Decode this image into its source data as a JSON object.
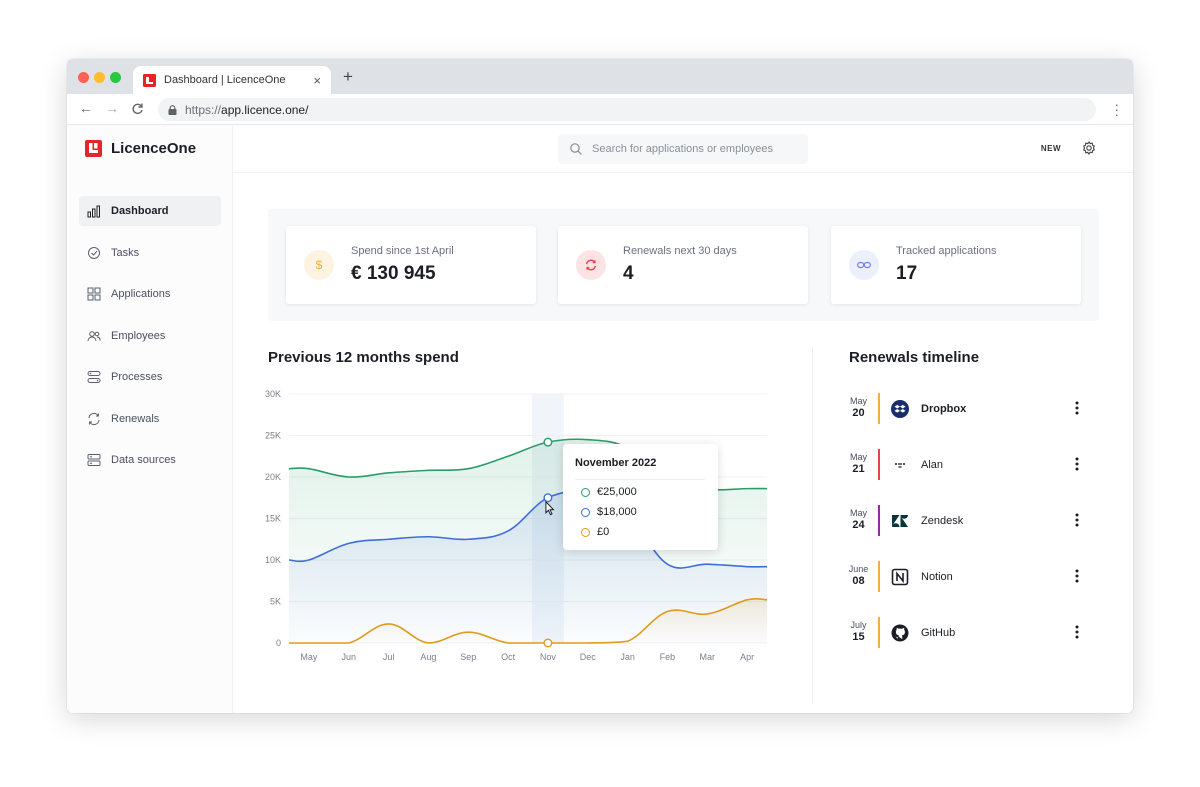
{
  "browser": {
    "tab_title": "Dashboard | LicenceOne",
    "tab_close": "×",
    "new_tab": "+",
    "url_protocol": "https://",
    "url_host": "app.licence.one/",
    "back": "←",
    "forward": "→",
    "reload": "C"
  },
  "app": {
    "logo_text": "LicenceOne",
    "brand_color": "#e8242b"
  },
  "sidebar": {
    "items": [
      {
        "label": "Dashboard",
        "icon": "bar-chart-icon",
        "active": true
      },
      {
        "label": "Tasks",
        "icon": "check-circle-icon",
        "active": false
      },
      {
        "label": "Applications",
        "icon": "grid-icon",
        "active": false
      },
      {
        "label": "Employees",
        "icon": "users-icon",
        "active": false
      },
      {
        "label": "Processes",
        "icon": "flow-icon",
        "active": false
      },
      {
        "label": "Renewals",
        "icon": "refresh-icon",
        "active": false
      },
      {
        "label": "Data sources",
        "icon": "server-icon",
        "active": false
      }
    ]
  },
  "header": {
    "search_placeholder": "Search for applications or employees",
    "new_label": "NEW"
  },
  "kpis": [
    {
      "label": "Spend since 1st April",
      "value": "€ 130 945",
      "icon": "dollar-icon",
      "color": "#f0b03a"
    },
    {
      "label": "Renewals next 30 days",
      "value": "4",
      "icon": "refresh-icon",
      "color": "#e8424a"
    },
    {
      "label": "Tracked applications",
      "value": "17",
      "icon": "link-icon",
      "color": "#6c7ff0"
    }
  ],
  "spend_chart": {
    "title": "Previous 12 months spend",
    "tooltip": {
      "title": "November 2022",
      "rows": [
        {
          "label": "€25,000",
          "color": "#2a9d6a"
        },
        {
          "label": "$18,000",
          "color": "#3d6fd6"
        },
        {
          "label": "£0",
          "color": "#e09a1e"
        }
      ]
    }
  },
  "chart_data": {
    "type": "area",
    "title": "Previous 12 months spend",
    "categories": [
      "May",
      "Jun",
      "Jul",
      "Aug",
      "Sep",
      "Oct",
      "Nov",
      "Dec",
      "Jan",
      "Feb",
      "Mar",
      "Apr"
    ],
    "yticks": [
      "0",
      "5K",
      "10K",
      "15K",
      "20K",
      "25K",
      "30K"
    ],
    "ylim": [
      0,
      30000
    ],
    "series": [
      {
        "color": "#2a9d6a",
        "values": [
          21000,
          20000,
          20500,
          20800,
          21000,
          22500,
          24200,
          24500,
          23500,
          19500,
          18500,
          18600
        ]
      },
      {
        "color": "#3d6fd6",
        "values": [
          10000,
          12000,
          12500,
          12800,
          12500,
          13500,
          17500,
          18000,
          15500,
          9500,
          9500,
          9200
        ]
      },
      {
        "color": "#e09a1e",
        "values": [
          0,
          0,
          2300,
          0,
          1300,
          0,
          0,
          0,
          200,
          3800,
          3500,
          5200
        ]
      }
    ],
    "highlight_index": 6,
    "grid": true
  },
  "timeline": {
    "title": "Renewals timeline",
    "items": [
      {
        "month": "May",
        "day": "20",
        "name": "Dropbox",
        "color": "#f0b03a",
        "icon": "dropbox-icon",
        "bold": true
      },
      {
        "month": "May",
        "day": "21",
        "name": "Alan",
        "color": "#e8424a",
        "icon": "alan-icon",
        "bold": false
      },
      {
        "month": "May",
        "day": "24",
        "name": "Zendesk",
        "color": "#8e2f9b",
        "icon": "zendesk-icon",
        "bold": false
      },
      {
        "month": "June",
        "day": "08",
        "name": "Notion",
        "color": "#f0b03a",
        "icon": "notion-icon",
        "bold": false
      },
      {
        "month": "July",
        "day": "15",
        "name": "GitHub",
        "color": "#f0b03a",
        "icon": "github-icon",
        "bold": false
      }
    ]
  }
}
